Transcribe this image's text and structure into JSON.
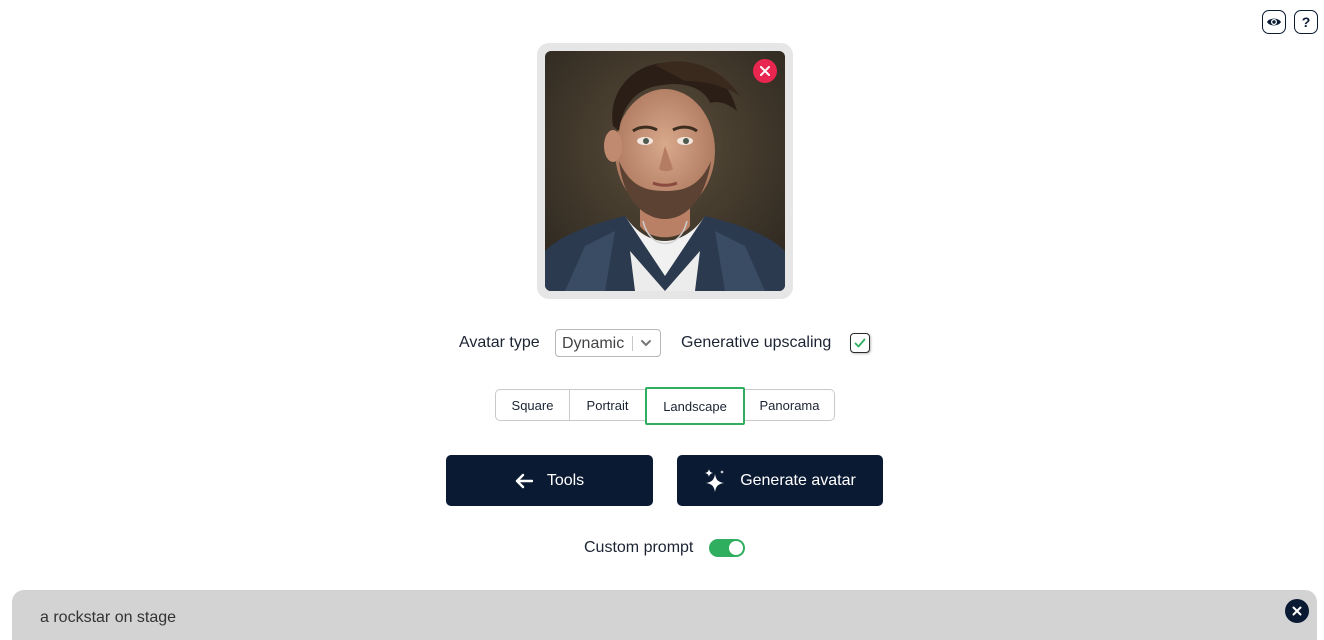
{
  "options": {
    "avatar_type_label": "Avatar type",
    "avatar_type_value": "Dynamic",
    "upscaling_label": "Generative upscaling",
    "upscaling_checked": true
  },
  "aspect": {
    "items": [
      "Square",
      "Portrait",
      "Landscape",
      "Panorama"
    ],
    "selected": "Landscape"
  },
  "buttons": {
    "tools_label": "Tools",
    "generate_label": "Generate avatar"
  },
  "prompt": {
    "toggle_label": "Custom prompt",
    "toggle_on": true,
    "text": "a rockstar on stage"
  },
  "colors": {
    "primary": "#0b1a33",
    "accent_green": "#2fae5f",
    "remove_red": "#e8264f",
    "prompt_bg": "#d3d3d3"
  }
}
